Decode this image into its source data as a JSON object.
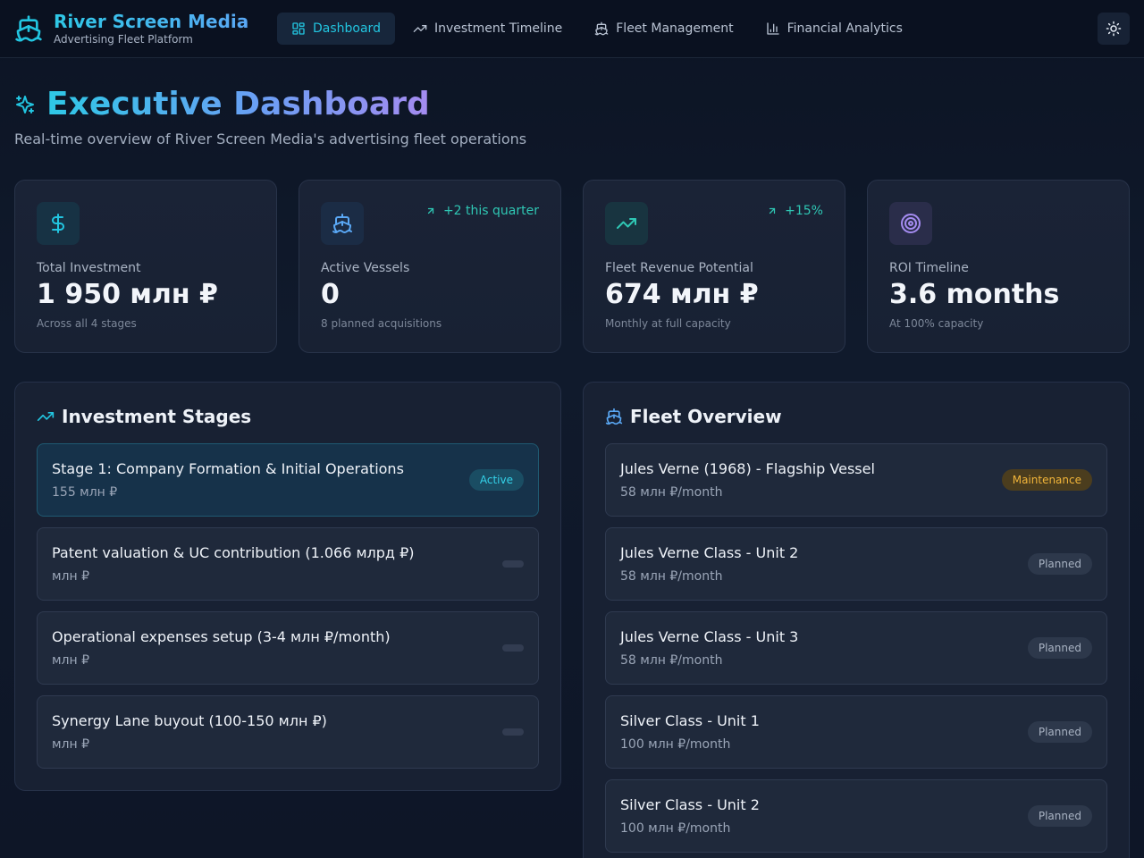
{
  "brand": {
    "title": "River Screen Media",
    "subtitle": "Advertising Fleet Platform",
    "icon": "ship-icon"
  },
  "nav": {
    "items": [
      {
        "label": "Dashboard",
        "icon": "layout-grid-icon",
        "active": true
      },
      {
        "label": "Investment Timeline",
        "icon": "trending-up-icon"
      },
      {
        "label": "Fleet Management",
        "icon": "ship-icon"
      },
      {
        "label": "Financial Analytics",
        "icon": "bar-chart-icon"
      }
    ],
    "theme_toggle": "sun-icon"
  },
  "header": {
    "title": "Executive Dashboard",
    "subtitle": "Real-time overview of River Screen Media's advertising fleet operations",
    "icon": "sparkles-icon"
  },
  "stats": [
    {
      "label": "Total Investment",
      "value": "1 950 млн ₽",
      "note": "Across all 4 stages",
      "trend": "",
      "icon": "dollar-icon",
      "color": "#22c5e0"
    },
    {
      "label": "Active Vessels",
      "value": "0",
      "note": "8 planned acquisitions",
      "trend": "+2 this quarter",
      "icon": "ship-icon",
      "color": "#5aa8f5"
    },
    {
      "label": "Fleet Revenue Potential",
      "value": "674 млн ₽",
      "note": "Monthly at full capacity",
      "trend": "+15%",
      "icon": "trending-up-icon",
      "color": "#2fc7b4"
    },
    {
      "label": "ROI Timeline",
      "value": "3.6 months",
      "note": "At 100% capacity",
      "trend": "",
      "icon": "target-icon",
      "color": "#a48bf0"
    }
  ],
  "stages": {
    "title": "Investment Stages",
    "items": [
      {
        "title": "Stage 1: Company Formation & Initial Operations",
        "amount": "155 млн ₽",
        "status": "Active"
      },
      {
        "title": "Patent valuation & UC contribution (1.066 млрд ₽)",
        "amount": "млн ₽",
        "status": ""
      },
      {
        "title": "Operational expenses setup (3-4 млн ₽/month)",
        "amount": "млн ₽",
        "status": ""
      },
      {
        "title": "Synergy Lane buyout (100-150 млн ₽)",
        "amount": "млн ₽",
        "status": ""
      }
    ]
  },
  "fleet": {
    "title": "Fleet Overview",
    "items": [
      {
        "name": "Jules Verne (1968) - Flagship Vessel",
        "revenue": "58 млн ₽/month",
        "status": "Maintenance"
      },
      {
        "name": "Jules Verne Class - Unit 2",
        "revenue": "58 млн ₽/month",
        "status": "Planned"
      },
      {
        "name": "Jules Verne Class - Unit 3",
        "revenue": "58 млн ₽/month",
        "status": "Planned"
      },
      {
        "name": "Silver Class - Unit 1",
        "revenue": "100 млн ₽/month",
        "status": "Planned"
      },
      {
        "name": "Silver Class - Unit 2",
        "revenue": "100 млн ₽/month",
        "status": "Planned"
      }
    ]
  },
  "colors": {
    "accent": "#22c5e0",
    "maintenance": "#f2b53a",
    "trend": "#2fc7b4"
  }
}
